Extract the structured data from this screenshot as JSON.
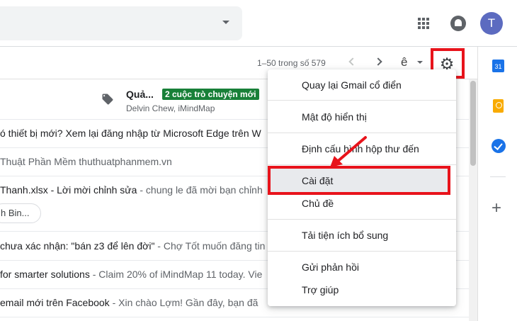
{
  "header": {
    "avatar_initial": "T"
  },
  "toolbar": {
    "pagination": "1–50 trong số 579",
    "input_tool_char": "ê",
    "settings_glyph": "⚙"
  },
  "promo": {
    "title": "Quả...",
    "badge": "2 cuộc trò chuyện mới",
    "senders": "Delvin Chew, iMindMap"
  },
  "mail_rows": [
    {
      "subject": "ó thiết bị mới? Xem lại đăng nhập từ Microsoft Edge trên W",
      "snippet": ""
    },
    {
      "subject": "",
      "snippet": " Thuật Phần Mềm thuthuatphanmem.vn"
    },
    {
      "subject": " Thanh.xlsx - Lời mời chỉnh sửa",
      "snippet": " - chung le đã mời bạn chỉnh"
    },
    {
      "subject": "chưa xác nhận: \"bán z3 để lên đời\"",
      "snippet": " - Chợ Tốt muốn đăng tin"
    },
    {
      "subject": "for smarter solutions",
      "snippet": " - Claim 20% of iMindMap 11 today. Vie"
    },
    {
      "subject": "email mới trên Facebook",
      "snippet": " - Xin chào Lợm! Gần đây, bạn đã"
    }
  ],
  "attachment_chip": "h Bin...",
  "sidebar": {
    "calendar_day": "31",
    "add_glyph": "+"
  },
  "settings_menu": {
    "items": [
      "Quay lại Gmail cổ điển",
      "Mật độ hiển thị",
      "Định cấu hình hộp thư đến",
      "Cài đặt",
      "Chủ đề",
      "Tải tiện ích bổ sung",
      "Gửi phản hồi",
      "Trợ giúp"
    ],
    "selected_index": 3
  },
  "colors": {
    "highlight_red": "#e8131b",
    "badge_green": "#188038",
    "avatar_purple": "#5c6bc0",
    "calendar_blue": "#1a73e8",
    "keep_yellow": "#f9ab00"
  }
}
